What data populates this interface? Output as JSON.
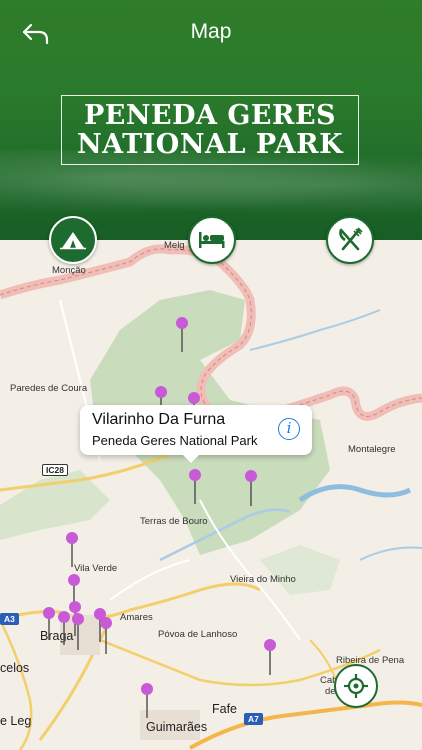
{
  "header": {
    "title": "Map",
    "banner_line1": "PENEDA GERES",
    "banner_line2": "NATIONAL PARK"
  },
  "categories": [
    {
      "name": "camping",
      "icon": "tent-icon",
      "selected": true
    },
    {
      "name": "hotels",
      "icon": "bed-icon",
      "selected": false
    },
    {
      "name": "restaurants",
      "icon": "fork-knife-icon",
      "selected": true
    }
  ],
  "callout": {
    "title": "Vilarinho Da Furna",
    "subtitle": "Peneda Geres National Park",
    "info_icon": "i"
  },
  "map_labels": {
    "moncao": "Monção",
    "melgaco": "Melg",
    "paredes": "Paredes de Coura",
    "montalegre": "Montalegre",
    "terras": "Terras de Bouro",
    "vilaverde": "Vila Verde",
    "amares": "Amares",
    "vieira": "Vieira do Minho",
    "braga": "Braga",
    "povoa": "Póvoa de Lanhoso",
    "celos": "celos",
    "ribeira": "Ribeira de Pena",
    "cabec": "Cabec",
    "deba": "de Ba",
    "fafe": "Fafe",
    "guimaraes": "Guimarães",
    "lega": "e Leg",
    "shield_ic28": "IC28",
    "shield_a3": "A3",
    "shield_a7": "A7"
  },
  "colors": {
    "header_green": "#2a7a2c",
    "pin": "#c85ad8",
    "park": "#c9dcbc",
    "border": "#f1b9b3"
  }
}
